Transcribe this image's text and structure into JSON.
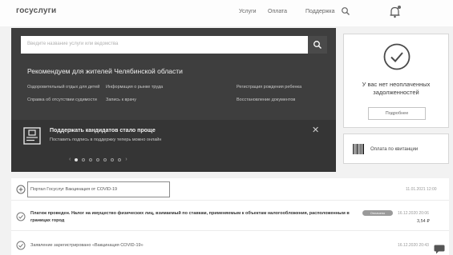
{
  "header": {
    "logo": "госуслуги",
    "nav": [
      "Услуги",
      "Оплата",
      "Поддержка"
    ],
    "icons": {
      "search": "search-icon",
      "notifications": "bell-icon"
    }
  },
  "hero": {
    "search_placeholder": "Введите название услуги или ведомства",
    "recommend_title": "Рекомендуем для жителей Челябинской области",
    "links": [
      "Оздоровительный отдых для детей",
      "Информация о рынке труда",
      "Регистрация рождения ребенка",
      "Справка об отсутствии судимости",
      "Запись к врачу",
      "Восстановление документов"
    ],
    "promo": {
      "title": "Поддержать кандидатов стало проще",
      "subtitle": "Поставить подпись в поддержку теперь можно онлайн",
      "close": "✕",
      "carousel": {
        "prev": "‹",
        "next": "›",
        "count": 7,
        "active": 1
      }
    }
  },
  "debt_card": {
    "text": "У вас нет неоплаченных задолженностей",
    "button": "Подробнее"
  },
  "receipt_card": {
    "label": "Оплата по квитанции"
  },
  "feed": [
    {
      "text": "Портал Госуслуг Вакцинация от COVID-19",
      "date": "11.01.2021 12:00"
    },
    {
      "text": "Платеж проведен. Налог на имущество физических лиц, взимаемый по ставкам, применяемым к объектам налогообложения, расположенным в границах город",
      "badge": "Оплачено",
      "date": "16.12.2020 20:06",
      "amount": "3,54 ₽"
    },
    {
      "text": "Заявление зарегистрировано «Вакцинация COVID-19»",
      "date": "16.12.2020 20:43"
    }
  ],
  "colors": {
    "hero_bg": "#3e3e3e",
    "promo_bg": "#353535",
    "page_bg": "#f2f2f2"
  }
}
